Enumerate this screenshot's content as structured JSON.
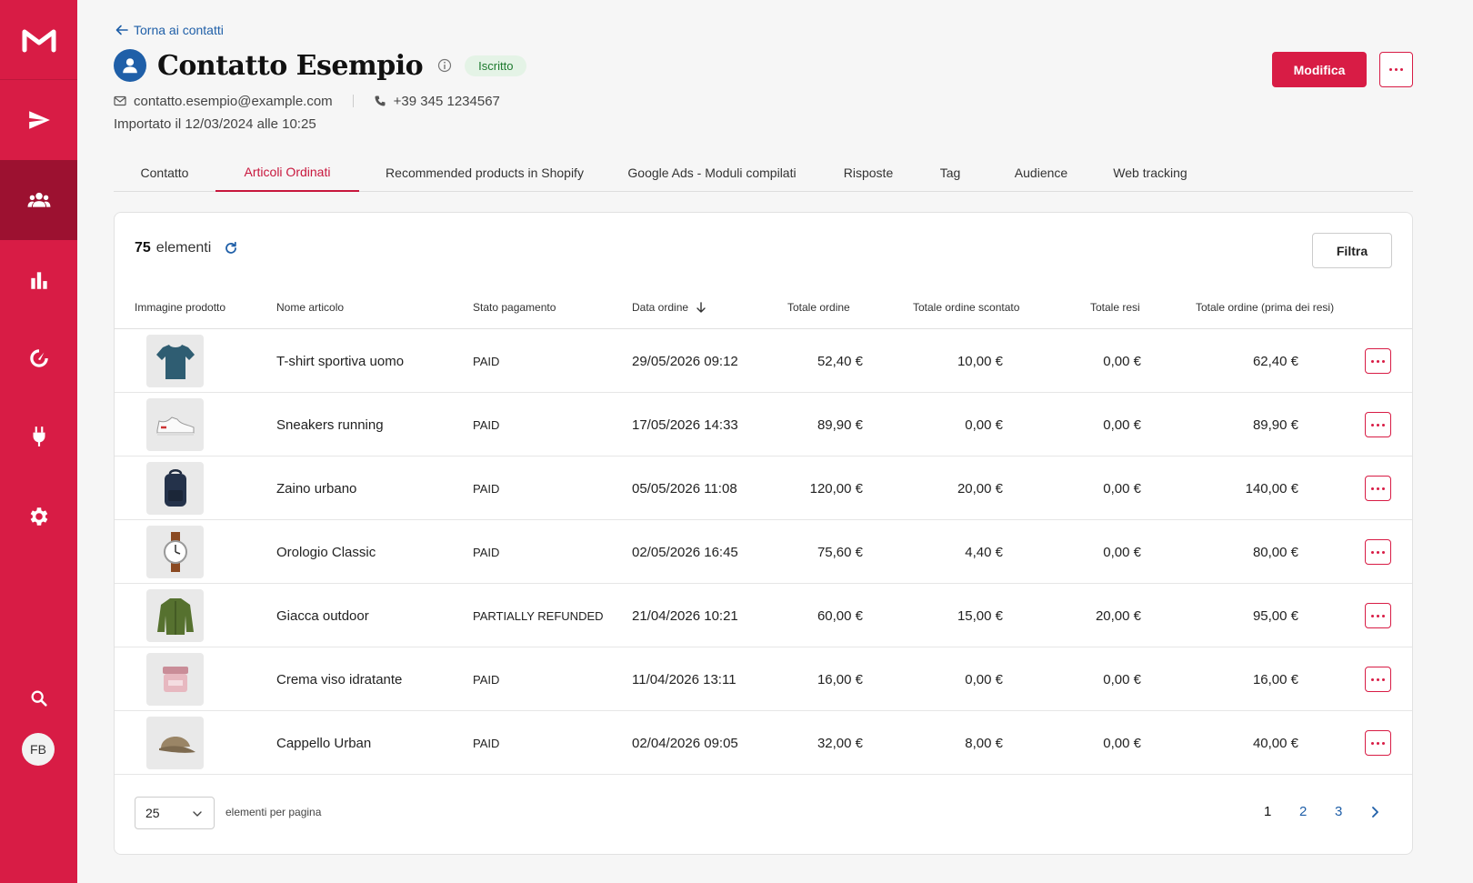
{
  "colors": {
    "brand": "#d81c45",
    "brand_dark": "#9c1130",
    "link": "#1f5fa8",
    "badge_bg": "#e4f3e6",
    "badge_text": "#1d7a2e"
  },
  "sidebar": {
    "items": [
      {
        "icon": "send-icon",
        "name": "campaigns"
      },
      {
        "icon": "users-icon",
        "name": "contacts",
        "active": true
      },
      {
        "icon": "bar-chart-icon",
        "name": "reports"
      },
      {
        "icon": "gauge-icon",
        "name": "automation"
      },
      {
        "icon": "plug-icon",
        "name": "integrations"
      },
      {
        "icon": "gear-icon",
        "name": "settings"
      }
    ],
    "avatar_initials": "FB"
  },
  "header": {
    "back_label": "Torna ai contatti",
    "title": "Contatto Esempio",
    "status_badge": "Iscritto",
    "email": "contatto.esempio@example.com",
    "phone": "+39 345 1234567",
    "imported": "Importato il 12/03/2024 alle 10:25",
    "edit_label": "Modifica"
  },
  "tabs": [
    {
      "label": "Contatto"
    },
    {
      "label": "Articoli Ordinati",
      "active": true
    },
    {
      "label": "Recommended products in Shopify"
    },
    {
      "label": "Google Ads - Moduli compilati"
    },
    {
      "label": "Risposte"
    },
    {
      "label": "Tag"
    },
    {
      "label": "Audience"
    },
    {
      "label": "Web tracking"
    }
  ],
  "table": {
    "count": "75",
    "count_label": "elementi",
    "filter_label": "Filtra",
    "columns": {
      "image": "Immagine prodotto",
      "name": "Nome articolo",
      "payment": "Stato pagamento",
      "date": "Data ordine",
      "total": "Totale ordine",
      "discounted": "Totale ordine scontato",
      "returns": "Totale resi",
      "before_returns": "Totale ordine (prima dei resi)"
    },
    "sort": {
      "column": "date",
      "direction": "descending"
    },
    "rows": [
      {
        "product_icon": "tshirt-icon",
        "name": "T-shirt sportiva uomo",
        "payment": "PAID",
        "date": "29/05/2026 09:12",
        "total": "52,40 €",
        "discounted": "10,00 €",
        "returns": "0,00 €",
        "before_returns": "62,40 €"
      },
      {
        "product_icon": "sneaker-icon",
        "name": "Sneakers running",
        "payment": "PAID",
        "date": "17/05/2026 14:33",
        "total": "89,90 €",
        "discounted": "0,00 €",
        "returns": "0,00 €",
        "before_returns": "89,90 €"
      },
      {
        "product_icon": "backpack-icon",
        "name": "Zaino urbano",
        "payment": "PAID",
        "date": "05/05/2026 11:08",
        "total": "120,00 €",
        "discounted": "20,00 €",
        "returns": "0,00 €",
        "before_returns": "140,00 €"
      },
      {
        "product_icon": "watch-icon",
        "name": "Orologio Classic",
        "payment": "PAID",
        "date": "02/05/2026 16:45",
        "total": "75,60 €",
        "discounted": "4,40 €",
        "returns": "0,00 €",
        "before_returns": "80,00 €"
      },
      {
        "product_icon": "jacket-icon",
        "name": "Giacca outdoor",
        "payment": "PARTIALLY REFUNDED",
        "date": "21/04/2026 10:21",
        "total": "60,00 €",
        "discounted": "15,00 €",
        "returns": "20,00 €",
        "before_returns": "95,00 €"
      },
      {
        "product_icon": "cream-jar-icon",
        "name": "Crema viso idratante",
        "payment": "PAID",
        "date": "11/04/2026 13:11",
        "total": "16,00 €",
        "discounted": "0,00 €",
        "returns": "0,00 €",
        "before_returns": "16,00 €"
      },
      {
        "product_icon": "cap-icon",
        "name": "Cappello Urban",
        "payment": "PAID",
        "date": "02/04/2026 09:05",
        "total": "32,00 €",
        "discounted": "8,00 €",
        "returns": "0,00 €",
        "before_returns": "40,00 €"
      }
    ]
  },
  "pagination": {
    "page_size": "25",
    "page_size_label": "elementi per pagina",
    "pages": [
      "1",
      "2",
      "3"
    ],
    "current": "1"
  }
}
